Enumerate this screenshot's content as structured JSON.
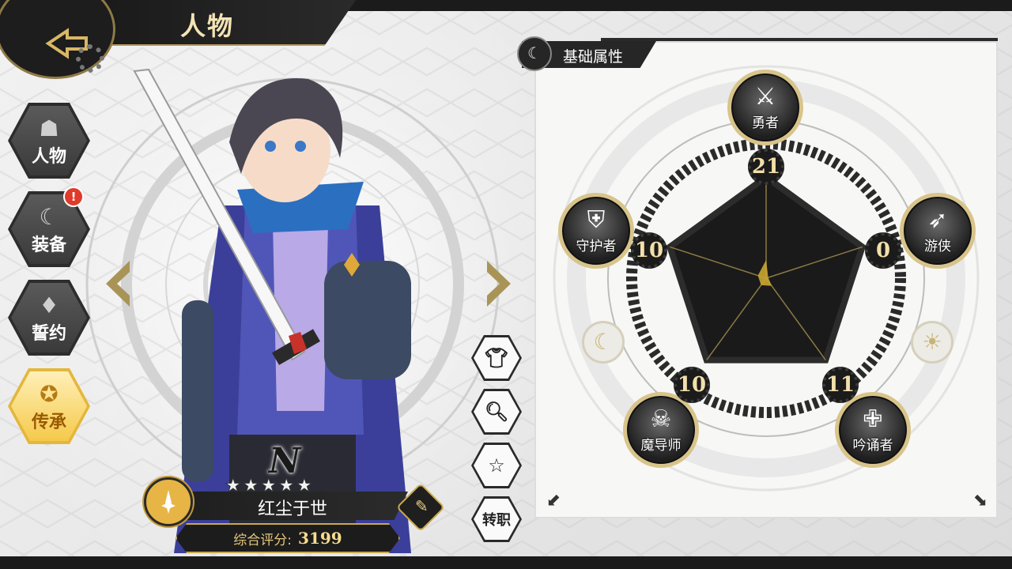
{
  "header": {
    "title": "人物"
  },
  "sidebar": {
    "items": [
      {
        "label": "人物",
        "icon": "hooded-figure-icon"
      },
      {
        "label": "装备",
        "icon": "crescent-moon-icon",
        "badge": "!"
      },
      {
        "label": "誓约",
        "icon": "crystal-icon"
      },
      {
        "label": "传承",
        "icon": "emblem-icon",
        "active": true
      }
    ]
  },
  "character": {
    "rank": "N",
    "stars": "★★★★★",
    "name": "红尘于世",
    "score_label": "综合评分:",
    "score_value": "3199"
  },
  "actions": {
    "costume_icon": "shirt-icon",
    "search_icon": "magnifier-icon",
    "star_icon": "star-icon",
    "job_change_label": "转职"
  },
  "attributes": {
    "title": "基础属性",
    "nodes": [
      {
        "name": "勇者",
        "value": "21",
        "icon": "sword-crest-icon"
      },
      {
        "name": "游侠",
        "value": "0",
        "icon": "bow-icon"
      },
      {
        "name": "吟诵者",
        "value": "11",
        "icon": "cross-orb-icon"
      },
      {
        "name": "魔导师",
        "value": "10",
        "icon": "skull-crest-icon"
      },
      {
        "name": "守护者",
        "value": "10",
        "icon": "shield-icon"
      }
    ],
    "radar": {
      "type": "radar",
      "axes": [
        "勇者",
        "游侠",
        "吟诵者",
        "魔导师",
        "守护者"
      ],
      "values": [
        21,
        0,
        11,
        10,
        10
      ]
    }
  },
  "colors": {
    "gold": "#c9a94c",
    "dark": "#1b1b1b",
    "active": "#f5c94a"
  }
}
